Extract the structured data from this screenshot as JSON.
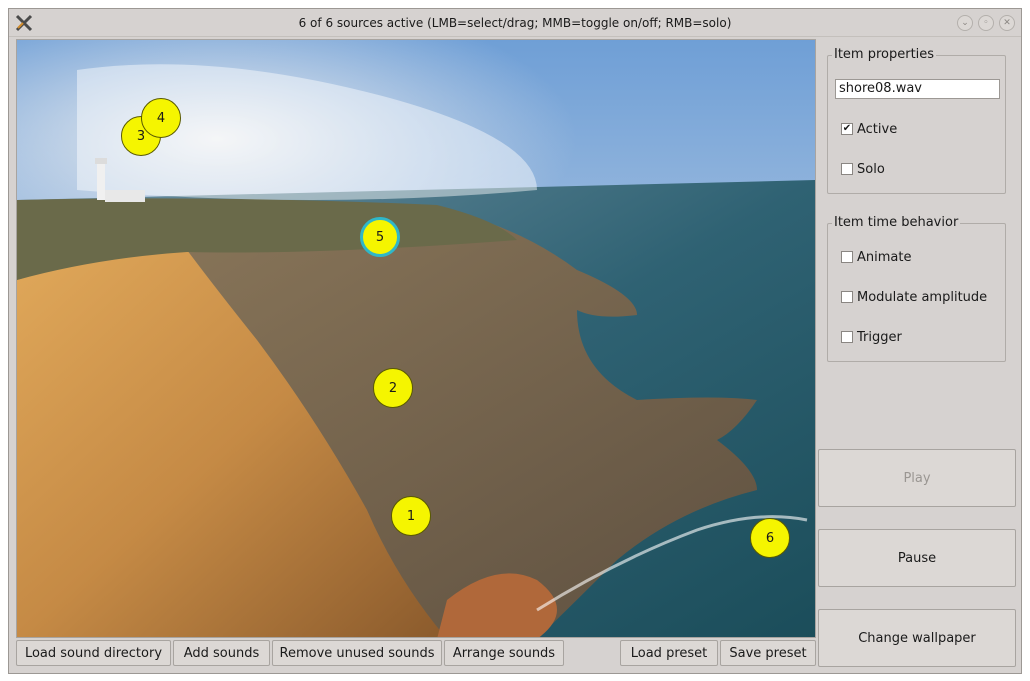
{
  "window": {
    "title": "6 of 6 sources active (LMB=select/drag; MMB=toggle on/off; RMB=solo)",
    "icons": [
      "app-icon",
      "minimize-icon",
      "maximize-icon",
      "close-icon"
    ]
  },
  "canvas": {
    "wallpaper": "sea cliff with lighthouse",
    "markers": [
      {
        "label": "1",
        "selected": false
      },
      {
        "label": "2",
        "selected": false
      },
      {
        "label": "3",
        "selected": false
      },
      {
        "label": "4",
        "selected": false
      },
      {
        "label": "5",
        "selected": true
      },
      {
        "label": "6",
        "selected": false
      }
    ],
    "marker_color": "#f5f500",
    "selected_ring_color": "#2fb7c9"
  },
  "bottom_bar": {
    "load_sound_directory": "Load sound directory",
    "add_sounds": "Add sounds",
    "remove_unused_sounds": "Remove unused sounds",
    "arrange_sounds": "Arrange sounds",
    "load_preset": "Load preset",
    "save_preset": "Save preset"
  },
  "item_properties": {
    "title": "Item properties",
    "filename": "shore08.wav",
    "active_label": "Active",
    "active_checked": true,
    "solo_label": "Solo",
    "solo_checked": false
  },
  "item_time_behavior": {
    "title": "Item time behavior",
    "animate_label": "Animate",
    "animate_checked": false,
    "modulate_label": "Modulate amplitude",
    "modulate_checked": false,
    "trigger_label": "Trigger",
    "trigger_checked": false
  },
  "side_buttons": {
    "play": "Play",
    "play_enabled": false,
    "pause": "Pause",
    "change_wallpaper": "Change wallpaper"
  },
  "glyphs": {
    "check": "✔"
  }
}
